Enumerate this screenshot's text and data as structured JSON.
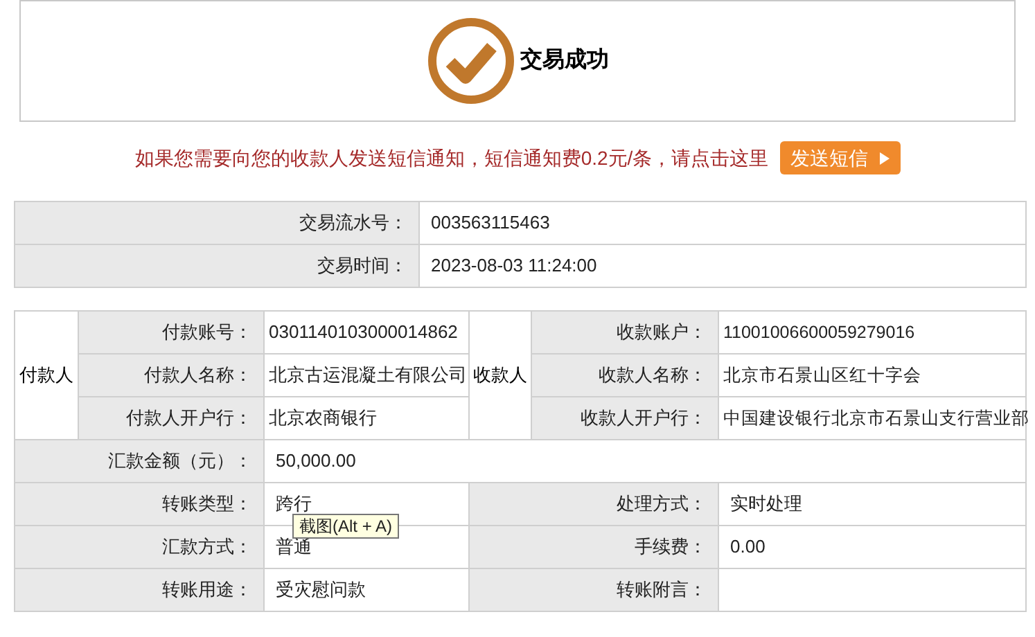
{
  "result": {
    "title": "交易成功"
  },
  "sms_notice": {
    "text": "如果您需要向您的收款人发送短信通知，短信通知费0.2元/条，请点击这里",
    "button": "发送短信"
  },
  "summary": [
    {
      "label": "交易流水号：",
      "value": "003563115463"
    },
    {
      "label": "交易时间：",
      "value": "2023-08-03 11:24:00"
    }
  ],
  "parties": {
    "payer": {
      "heading": "付款人",
      "fields": [
        {
          "label": "付款账号：",
          "value": "0301140103000014862"
        },
        {
          "label": "付款人名称：",
          "value": "北京古运混凝土有限公司"
        },
        {
          "label": "付款人开户行：",
          "value": "北京农商银行"
        }
      ]
    },
    "payee": {
      "heading": "收款人",
      "fields": [
        {
          "label": "收款账户：",
          "value": "11001006600059279016"
        },
        {
          "label": "收款人名称：",
          "value": "北京市石景山区红十字会"
        },
        {
          "label": "收款人开户行：",
          "value": "中国建设银行北京市石景山支行营业部"
        }
      ]
    }
  },
  "amount": {
    "label": "汇款金额（元）：",
    "value": "50,000.00"
  },
  "details": [
    [
      {
        "label": "转账类型：",
        "value": "跨行"
      },
      {
        "label": "处理方式：",
        "value": "实时处理"
      }
    ],
    [
      {
        "label": "汇款方式：",
        "value": "普通"
      },
      {
        "label": "手续费：",
        "value": "0.00"
      }
    ],
    [
      {
        "label": "转账用途：",
        "value": "受灾慰问款"
      },
      {
        "label": "转账附言："
      }
    ]
  ],
  "tooltip": {
    "text": "截图(Alt + A)"
  }
}
